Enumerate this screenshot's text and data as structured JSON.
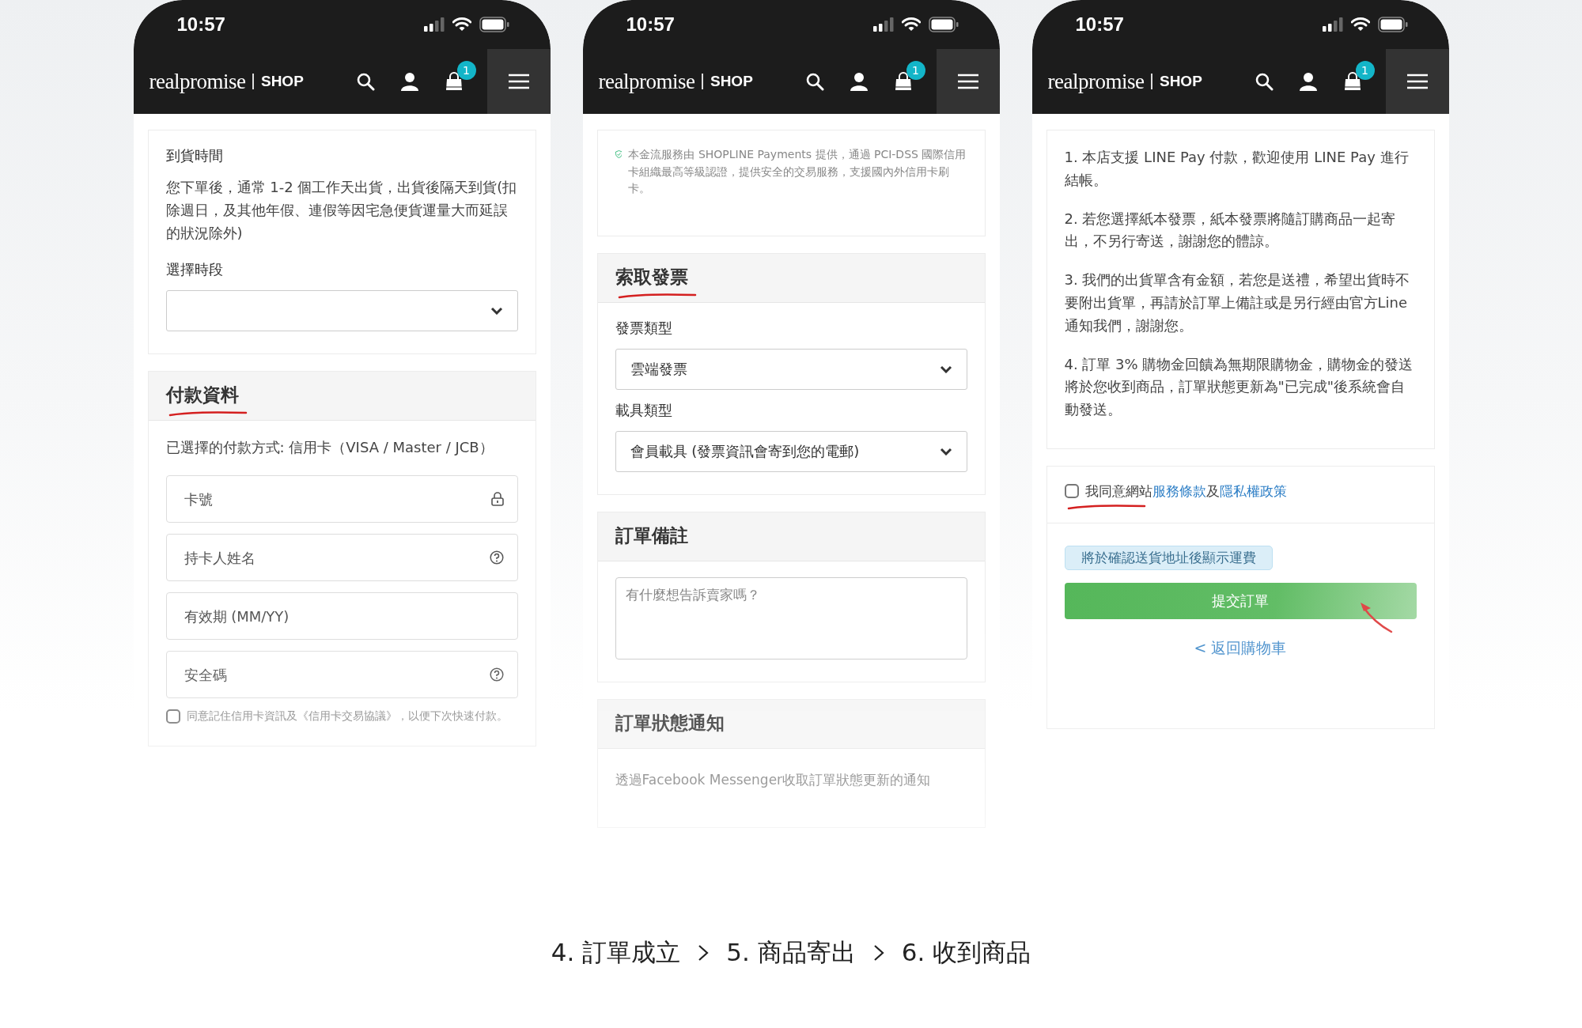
{
  "phones": [
    {
      "status_time": "10:57",
      "logo": "realpromise",
      "logo_suffix": "SHOP",
      "cart_count": "1",
      "sections": [
        {
          "groups": [
            [
              {
                "kind": "label",
                "text": "到貨時間"
              },
              {
                "kind": "paragraph",
                "text": "您下單後，通常 1-2 個工作天出貨，出貨後隔天到貨(扣除週日，及其他年假、連假等因宅急便貨運量大而延誤的狀況除外)"
              },
              {
                "kind": "label",
                "text": "選擇時段"
              },
              {
                "kind": "select"
              }
            ]
          ]
        },
        {
          "title": "付款資料",
          "annotated": true,
          "groups": [
            [
              {
                "kind": "paragraph",
                "text": "已選擇的付款方式: 信用卡（VISA / Master / JCB）"
              },
              {
                "kind": "locked_input",
                "placeholder": "卡號"
              },
              {
                "kind": "help_input",
                "placeholder": "持卡人姓名"
              },
              {
                "kind": "input",
                "placeholder": "有效期 (MM/YY)"
              },
              {
                "kind": "help_input",
                "placeholder": "安全碼"
              },
              {
                "kind": "checkbox",
                "checked": false,
                "parts": [
                  {
                    "text": "同意記住信用卡資訊及《信用卡交易協議》，以便下次快速付款。",
                    "link": false
                  }
                ]
              }
            ]
          ]
        }
      ]
    },
    {
      "status_time": "10:57",
      "logo": "realpromise",
      "logo_suffix": "SHOP",
      "cart_count": "1",
      "sections": [
        {
          "groups": [
            [
              {
                "kind": "secure_note",
                "text": "本金流服務由 SHOPLINE Payments 提供，通過 PCI-DSS 國際信用卡組織最高等級認證，提供安全的交易服務，支援國內外信用卡刷卡。"
              }
            ]
          ]
        },
        {
          "title": "索取發票",
          "annotated": true,
          "groups": [
            [
              {
                "kind": "label",
                "text": "發票類型"
              },
              {
                "kind": "select",
                "value": "雲端發票"
              },
              {
                "kind": "label",
                "text": "載具類型"
              },
              {
                "kind": "select",
                "value": "會員載具 (發票資訊會寄到您的電郵)"
              }
            ]
          ]
        },
        {
          "title": "訂單備註",
          "annotated": false,
          "groups": [
            [
              {
                "kind": "textarea",
                "placeholder": "有什麼想告訴賣家嗎？"
              }
            ]
          ]
        },
        {
          "title": "訂單狀態通知",
          "annotated": false,
          "groups": [
            [
              {
                "kind": "hint",
                "text": "透過Facebook Messenger收取訂單狀態更新的通知"
              }
            ]
          ]
        }
      ]
    },
    {
      "status_time": "10:57",
      "logo": "realpromise",
      "logo_suffix": "SHOP",
      "cart_count": "1",
      "sections": [
        {
          "groups": [
            [
              {
                "kind": "paragraph",
                "text": "1. 本店支援 LINE Pay 付款，歡迎使用 LINE Pay 進行結帳。"
              },
              {
                "kind": "paragraph",
                "text": "2. 若您選擇紙本發票，紙本發票將隨訂購商品一起寄出，不另行寄送，謝謝您的體諒。"
              },
              {
                "kind": "paragraph",
                "text": "3. 我們的出貨單含有金額，若您是送禮，希望出貨時不要附出貨單，再請於訂單上備註或是另行經由官方Line通知我們，謝謝您。"
              },
              {
                "kind": "paragraph",
                "text": "4. 訂單 3% 購物金回饋為無期限購物金，購物金的發送將於您收到商品，訂單狀態更新為\"已完成\"後系統會自動發送。"
              }
            ]
          ]
        },
        {
          "groups": [
            [
              {
                "kind": "checkbox",
                "checked": false,
                "annotated": true,
                "parts": [
                  {
                    "text": "我同意網站",
                    "link": false
                  },
                  {
                    "text": "服務條款",
                    "link": true
                  },
                  {
                    "text": "及",
                    "link": false
                  },
                  {
                    "text": "隱私權政策",
                    "link": true
                  }
                ]
              }
            ],
            [
              {
                "kind": "badge",
                "text": "將於確認送貨地址後顯示運費"
              },
              {
                "kind": "button",
                "text": "提交訂單",
                "annotated": true
              },
              {
                "kind": "link",
                "text": "< 返回購物車"
              }
            ]
          ]
        }
      ]
    }
  ],
  "steps": [
    {
      "label": "4. 訂單成立"
    },
    {
      "label": "5. 商品寄出"
    },
    {
      "label": "6. 收到商品"
    }
  ]
}
